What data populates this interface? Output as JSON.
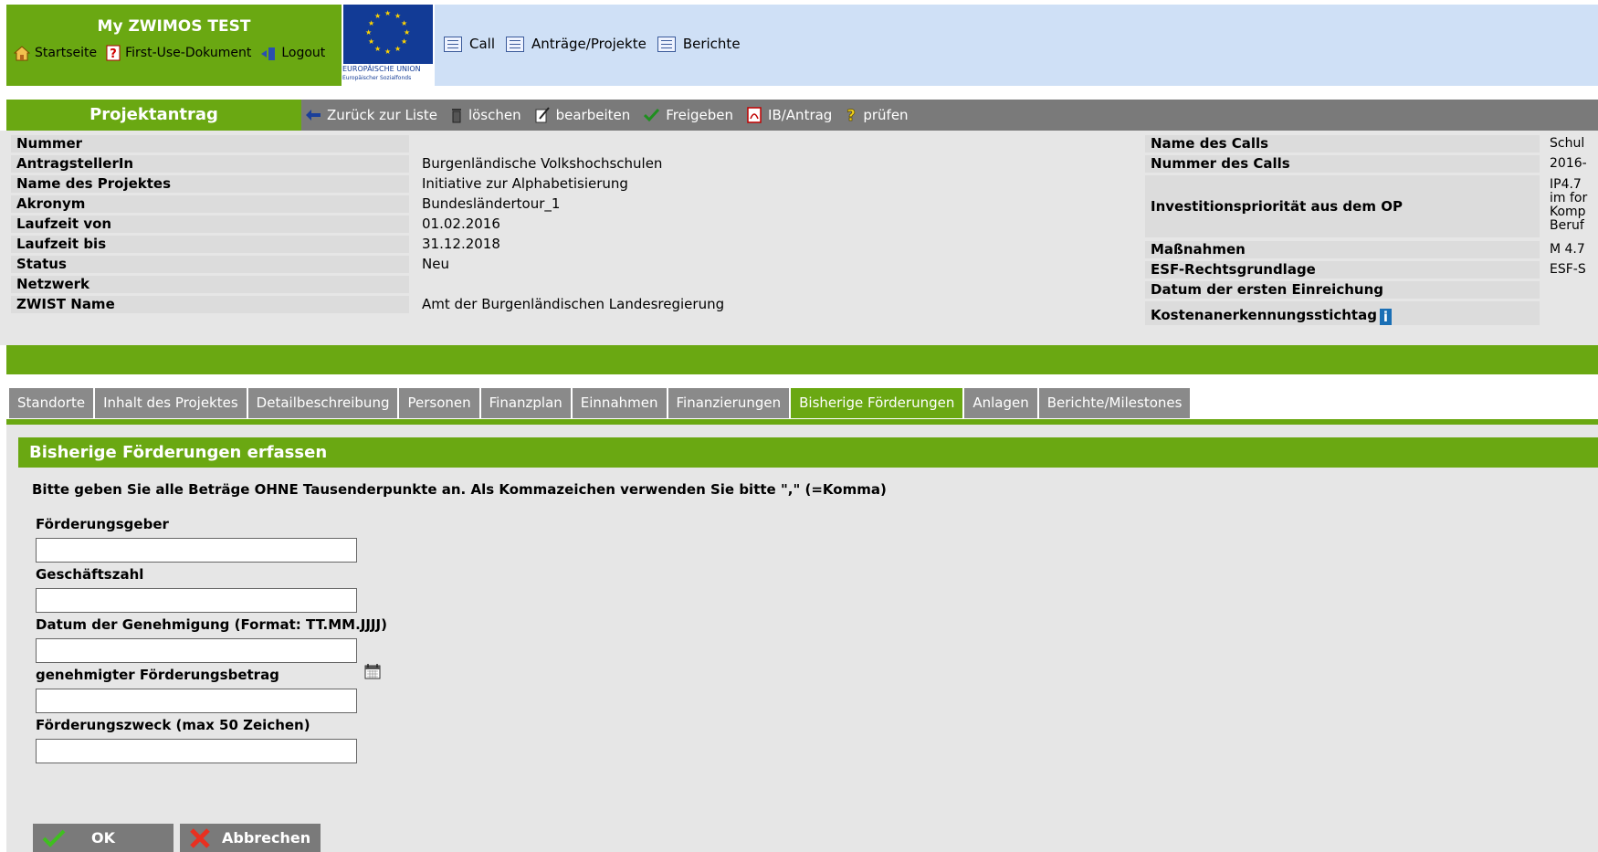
{
  "header": {
    "app_title": "My ZWIMOS TEST",
    "links": [
      {
        "label": "Startseite",
        "icon": "home-icon"
      },
      {
        "label": "First-Use-Dokument",
        "icon": "help-icon"
      },
      {
        "label": "Logout",
        "icon": "logout-icon"
      }
    ],
    "eu_logo": {
      "line1": "EUROPÄISCHE UNION",
      "line2": "Europäischer Sozialfonds"
    },
    "nav": [
      {
        "label": "Call",
        "icon": "list-icon"
      },
      {
        "label": "Anträge/Projekte",
        "icon": "list-icon"
      },
      {
        "label": "Berichte",
        "icon": "list-icon"
      }
    ]
  },
  "actionbar": {
    "section_title": "Projektantrag",
    "actions": [
      {
        "label": "Zurück zur Liste",
        "icon": "back-arrow-icon"
      },
      {
        "label": "löschen",
        "icon": "trash-icon"
      },
      {
        "label": "bearbeiten",
        "icon": "edit-icon"
      },
      {
        "label": "Freigeben",
        "icon": "checkmark-icon"
      },
      {
        "label": "IB/Antrag",
        "icon": "pdf-icon"
      },
      {
        "label": "prüfen",
        "icon": "question-icon"
      }
    ]
  },
  "project_info": {
    "left": [
      {
        "label": "Nummer",
        "value": ""
      },
      {
        "label": "AntragstellerIn",
        "value": "Burgenländische Volkshochschulen"
      },
      {
        "label": "Name des Projektes",
        "value": "Initiative zur Alphabetisierung"
      },
      {
        "label": "Akronym",
        "value": "Bundesländertour_1"
      },
      {
        "label": "Laufzeit von",
        "value": "01.02.2016"
      },
      {
        "label": "Laufzeit bis",
        "value": "31.12.2018"
      },
      {
        "label": "Status",
        "value": "Neu"
      },
      {
        "label": "Netzwerk",
        "value": ""
      },
      {
        "label": "ZWIST Name",
        "value": "Amt der Burgenländischen Landesregierung"
      }
    ],
    "right": [
      {
        "label": "Name des Calls",
        "value": "Schul"
      },
      {
        "label": "Nummer des Calls",
        "value": "2016-"
      },
      {
        "label": "Investitionspriorität aus dem OP",
        "value_lines": [
          "IP4.7",
          "im for",
          "Komp",
          "Beruf"
        ]
      },
      {
        "label": "Maßnahmen",
        "value": "M 4.7"
      },
      {
        "label": "ESF-Rechtsgrundlage",
        "value": "ESF-S"
      },
      {
        "label": "Datum der ersten Einreichung",
        "value": ""
      },
      {
        "label": "Kostenanerkennungsstichtag",
        "value": "",
        "info_icon": "i"
      }
    ]
  },
  "tabs": [
    {
      "label": "Standorte",
      "active": false
    },
    {
      "label": "Inhalt des Projektes",
      "active": false
    },
    {
      "label": "Detailbeschreibung",
      "active": false
    },
    {
      "label": "Personen",
      "active": false
    },
    {
      "label": "Finanzplan",
      "active": false
    },
    {
      "label": "Einnahmen",
      "active": false
    },
    {
      "label": "Finanzierungen",
      "active": false
    },
    {
      "label": "Bisherige Förderungen",
      "active": true
    },
    {
      "label": "Anlagen",
      "active": false
    },
    {
      "label": "Berichte/Milestones",
      "active": false
    }
  ],
  "form": {
    "header": "Bisherige Förderungen erfassen",
    "note": "Bitte geben Sie alle Beträge OHNE Tausenderpunkte an. Als Kommazeichen verwenden Sie bitte \",\" (=Komma)",
    "fields": [
      {
        "label": "Förderungsgeber",
        "value": ""
      },
      {
        "label": "Geschäftszahl",
        "value": ""
      },
      {
        "label": "Datum der Genehmigung (Format: TT.MM.JJJJ)",
        "value": "",
        "icon": "calendar-icon"
      },
      {
        "label": "genehmigter Förderungsbetrag",
        "value": ""
      },
      {
        "label": "Förderungszweck (max 50 Zeichen)",
        "value": ""
      }
    ],
    "buttons": {
      "ok": "OK",
      "cancel": "Abbrechen"
    }
  },
  "colors": {
    "brand_green": "#6aa812",
    "header_blue": "#cfe0f6",
    "bar_gray": "#7a7a7a",
    "panel_gray": "#e6e6e6"
  }
}
